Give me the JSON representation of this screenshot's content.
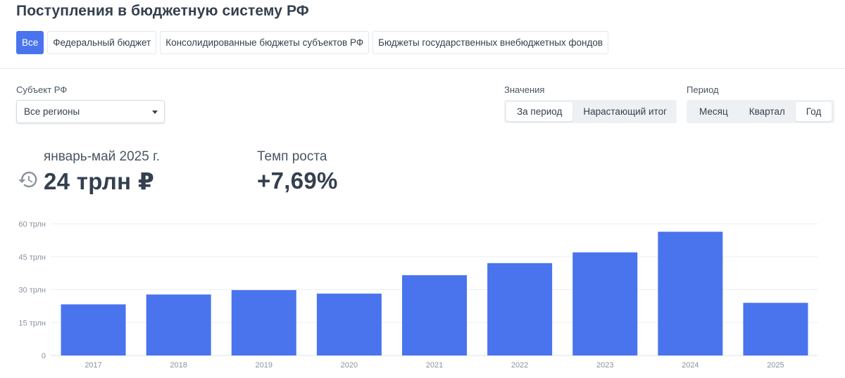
{
  "page": {
    "title": "Поступления в бюджетную систему РФ"
  },
  "budget_tabs": [
    {
      "label": "Все",
      "active": true
    },
    {
      "label": "Федеральный бюджет",
      "active": false
    },
    {
      "label": "Консолидированные бюджеты субъектов РФ",
      "active": false
    },
    {
      "label": "Бюджеты государственных внебюджетных фондов",
      "active": false
    }
  ],
  "filters": {
    "subject": {
      "label": "Субъект РФ",
      "value": "Все регионы"
    },
    "values": {
      "label": "Значения",
      "options": [
        {
          "label": "За период",
          "active": true
        },
        {
          "label": "Нарастающий итог",
          "active": false
        }
      ]
    },
    "period": {
      "label": "Период",
      "options": [
        {
          "label": "Месяц",
          "active": false
        },
        {
          "label": "Квартал",
          "active": false
        },
        {
          "label": "Год",
          "active": true
        }
      ]
    }
  },
  "kpi": {
    "period_label": "январь-май 2025 г.",
    "total_value": "24 трлн ₽",
    "growth_label": "Темп роста",
    "growth_value": "+7,69%",
    "icon": "history-icon"
  },
  "colors": {
    "accent": "#4a74ed",
    "bar": "#4a74ed",
    "text": "#34404f",
    "grid": "#eceff3"
  },
  "chart_data": {
    "type": "bar",
    "categories": [
      "2017",
      "2018",
      "2019",
      "2020",
      "2021",
      "2022",
      "2023",
      "2024",
      "2025"
    ],
    "values": [
      23.3,
      27.8,
      29.8,
      28.2,
      36.6,
      42.1,
      47,
      56.4,
      24
    ],
    "ylim": [
      0,
      60
    ],
    "yticks": [
      0,
      15,
      30,
      45,
      60
    ],
    "ytick_labels": [
      "0",
      "15 трлн",
      "30 трлн",
      "45 трлн",
      "60 трлн"
    ],
    "grid": true,
    "title": "",
    "xlabel": "",
    "ylabel": ""
  }
}
